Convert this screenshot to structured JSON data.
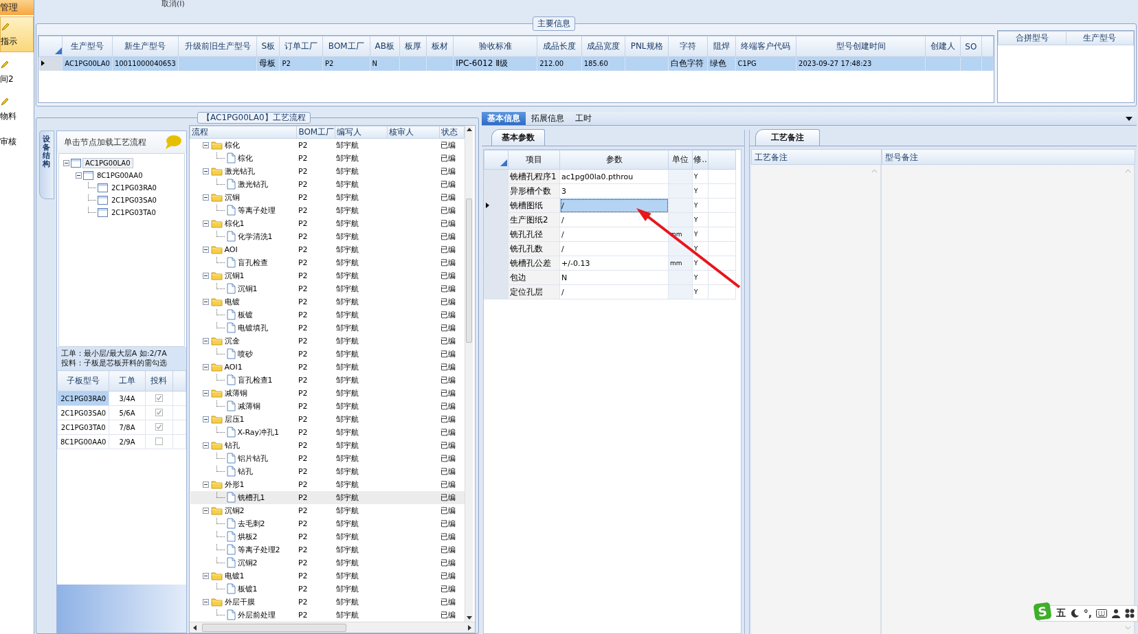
{
  "top_strip": {
    "cut_label": "取消(I)"
  },
  "sidebar": {
    "items": [
      {
        "kind": "header",
        "label": "管理"
      },
      {
        "kind": "icon_item",
        "label": "指示",
        "selected": true
      },
      {
        "kind": "icon_item",
        "label": "间2",
        "selected": false
      },
      {
        "kind": "icon_item",
        "label": "物料",
        "selected": false
      },
      {
        "kind": "item",
        "label": "审核",
        "selected": false
      }
    ]
  },
  "main_info": {
    "title": "主要信息",
    "columns": [
      "生产型号",
      "新生产型号",
      "升级前旧生产型号",
      "S板",
      "订单工厂",
      "BOM工厂",
      "AB板",
      "板厚",
      "板材",
      "验收标准",
      "成品长度",
      "成品宽度",
      "PNL规格",
      "字符",
      "阻焊",
      "终端客户代码",
      "型号创建时间",
      "创建人",
      "SO"
    ],
    "rows": [
      {
        "selected": true,
        "cells": [
          "AC1PG00LA0",
          "10011000040653",
          null,
          "母板",
          "P2",
          "P2",
          "N",
          null,
          null,
          "IPC-6012 Ⅱ级",
          "212.00",
          "185.60",
          null,
          "白色字符",
          "绿色",
          "C1PG",
          "2023-09-27 17:48:23",
          null,
          null
        ]
      }
    ],
    "merge_columns": [
      "合拼型号",
      "生产型号"
    ]
  },
  "process": {
    "title": "【AC1PG00LA0】工艺流程",
    "side_tab": "设备结构",
    "tree_hint": "单击节点加载工艺流程",
    "structure": [
      {
        "label": "AC1PG00LA0",
        "selected": true,
        "expanded": true,
        "children": [
          {
            "label": "8C1PG00AA0",
            "selected": false,
            "expanded": true,
            "children": [
              {
                "label": "2C1PG03RA0",
                "selected": false
              },
              {
                "label": "2C1PG03SA0",
                "selected": false
              },
              {
                "label": "2C1PG03TA0",
                "selected": false
              }
            ]
          }
        ]
      }
    ],
    "notes": [
      "工单：最小层/最大层A 如:2/7A",
      "投料：子板是芯板开料的需勾选"
    ],
    "sub_columns": [
      "子板型号",
      "工单",
      "投料"
    ],
    "sub_rows": [
      {
        "model": "2C1PG03RA0",
        "order": "3/4A",
        "checked": true,
        "selected": true
      },
      {
        "model": "2C1PG03SA0",
        "order": "5/6A",
        "checked": true,
        "selected": false
      },
      {
        "model": "2C1PG03TA0",
        "order": "7/8A",
        "checked": true,
        "selected": false
      },
      {
        "model": "8C1PG00AA0",
        "order": "2/9A",
        "checked": false,
        "selected": false
      }
    ],
    "flow_columns": [
      "流程",
      "BOM工厂",
      "编写人",
      "核审人",
      "状态"
    ],
    "flow": [
      {
        "label": "棕化",
        "bom": "P2",
        "writer": "邹宇航",
        "status": "已编",
        "expanded": true,
        "selected": false,
        "children": [
          {
            "label": "棕化",
            "bom": "P2",
            "writer": "邹宇航",
            "status": "已编",
            "selected": false
          }
        ]
      },
      {
        "label": "激光钻孔",
        "bom": "P2",
        "writer": "邹宇航",
        "status": "已编",
        "expanded": true,
        "selected": false,
        "children": [
          {
            "label": "激光钻孔",
            "bom": "P2",
            "writer": "邹宇航",
            "status": "已编",
            "selected": false
          }
        ]
      },
      {
        "label": "沉铜",
        "bom": "P2",
        "writer": "邹宇航",
        "status": "已编",
        "expanded": true,
        "selected": false,
        "children": [
          {
            "label": "等离子处理",
            "bom": "P2",
            "writer": "邹宇航",
            "status": "已编",
            "selected": false
          }
        ]
      },
      {
        "label": "棕化1",
        "bom": "P2",
        "writer": "邹宇航",
        "status": "已编",
        "expanded": true,
        "selected": false,
        "children": [
          {
            "label": "化学清洗1",
            "bom": "P2",
            "writer": "邹宇航",
            "status": "已编",
            "selected": false
          }
        ]
      },
      {
        "label": "AOI",
        "bom": "P2",
        "writer": "邹宇航",
        "status": "已编",
        "expanded": true,
        "selected": false,
        "children": [
          {
            "label": "盲孔检查",
            "bom": "P2",
            "writer": "邹宇航",
            "status": "已编",
            "selected": false
          }
        ]
      },
      {
        "label": "沉铜1",
        "bom": "P2",
        "writer": "邹宇航",
        "status": "已编",
        "expanded": true,
        "selected": false,
        "children": [
          {
            "label": "沉铜1",
            "bom": "P2",
            "writer": "邹宇航",
            "status": "已编",
            "selected": false
          }
        ]
      },
      {
        "label": "电镀",
        "bom": "P2",
        "writer": "邹宇航",
        "status": "已编",
        "expanded": true,
        "selected": false,
        "children": [
          {
            "label": "板镀",
            "bom": "P2",
            "writer": "邹宇航",
            "status": "已编",
            "selected": false
          },
          {
            "label": "电镀填孔",
            "bom": "P2",
            "writer": "邹宇航",
            "status": "已编",
            "selected": false
          }
        ]
      },
      {
        "label": "沉金",
        "bom": "P2",
        "writer": "邹宇航",
        "status": "已编",
        "expanded": true,
        "selected": false,
        "children": [
          {
            "label": "喷砂",
            "bom": "P2",
            "writer": "邹宇航",
            "status": "已编",
            "selected": false
          }
        ]
      },
      {
        "label": "AOI1",
        "bom": "P2",
        "writer": "邹宇航",
        "status": "已编",
        "expanded": true,
        "selected": false,
        "children": [
          {
            "label": "盲孔检查1",
            "bom": "P2",
            "writer": "邹宇航",
            "status": "已编",
            "selected": false
          }
        ]
      },
      {
        "label": "减薄铜",
        "bom": "P2",
        "writer": "邹宇航",
        "status": "已编",
        "expanded": true,
        "selected": false,
        "children": [
          {
            "label": "减薄铜",
            "bom": "P2",
            "writer": "邹宇航",
            "status": "已编",
            "selected": false
          }
        ]
      },
      {
        "label": "层压1",
        "bom": "P2",
        "writer": "邹宇航",
        "status": "已编",
        "expanded": true,
        "selected": false,
        "children": [
          {
            "label": "X-Ray冲孔1",
            "bom": "P2",
            "writer": "邹宇航",
            "status": "已编",
            "selected": false
          }
        ]
      },
      {
        "label": "钻孔",
        "bom": "P2",
        "writer": "邹宇航",
        "status": "已编",
        "expanded": true,
        "selected": false,
        "children": [
          {
            "label": "铝片钻孔",
            "bom": "P2",
            "writer": "邹宇航",
            "status": "已编",
            "selected": false
          },
          {
            "label": "钻孔",
            "bom": "P2",
            "writer": "邹宇航",
            "status": "已编",
            "selected": false
          }
        ]
      },
      {
        "label": "外形1",
        "bom": "P2",
        "writer": "邹宇航",
        "status": "已编",
        "expanded": true,
        "selected": false,
        "children": [
          {
            "label": "铣槽孔1",
            "bom": "P2",
            "writer": "邹宇航",
            "status": "已编",
            "selected": true
          }
        ]
      },
      {
        "label": "沉铜2",
        "bom": "P2",
        "writer": "邹宇航",
        "status": "已编",
        "expanded": true,
        "selected": false,
        "children": [
          {
            "label": "去毛刺2",
            "bom": "P2",
            "writer": "邹宇航",
            "status": "已编",
            "selected": false
          },
          {
            "label": "烘板2",
            "bom": "P2",
            "writer": "邹宇航",
            "status": "已编",
            "selected": false
          },
          {
            "label": "等离子处理2",
            "bom": "P2",
            "writer": "邹宇航",
            "status": "已编",
            "selected": false
          },
          {
            "label": "沉铜2",
            "bom": "P2",
            "writer": "邹宇航",
            "status": "已编",
            "selected": false
          }
        ]
      },
      {
        "label": "电镀1",
        "bom": "P2",
        "writer": "邹宇航",
        "status": "已编",
        "expanded": true,
        "selected": false,
        "children": [
          {
            "label": "板镀1",
            "bom": "P2",
            "writer": "邹宇航",
            "status": "已编",
            "selected": false
          }
        ]
      },
      {
        "label": "外层干膜",
        "bom": "P2",
        "writer": "邹宇航",
        "status": "已编",
        "expanded": true,
        "selected": false,
        "children": [
          {
            "label": "外层前处理",
            "bom": "P2",
            "writer": "邹宇航",
            "status": "已编",
            "selected": false
          }
        ]
      }
    ]
  },
  "detail_tabs": [
    {
      "label": "基本信息",
      "selected": true
    },
    {
      "label": "拓展信息",
      "selected": false
    },
    {
      "label": "工时",
      "selected": false
    }
  ],
  "basic_params": {
    "tab": "基本参数",
    "columns": [
      "项目",
      "参数",
      "单位",
      "修.."
    ],
    "rows": [
      {
        "item": "铣槽孔程序1",
        "value": "ac1pg00la0.pthrou",
        "flag": "Y",
        "selected": false
      },
      {
        "item": "异形槽个数",
        "value": "3",
        "flag": "Y",
        "selected": false
      },
      {
        "item": "铣槽图纸",
        "value": "/",
        "flag": "Y",
        "selected": true
      },
      {
        "item": "生产图纸2",
        "value": "/",
        "flag": "Y",
        "selected": false
      },
      {
        "item": "铣孔孔径",
        "value": "/",
        "unit": "mm",
        "flag": "Y",
        "selected": false
      },
      {
        "item": "铣孔孔数",
        "value": "/",
        "flag": "Y",
        "selected": false
      },
      {
        "item": "铣槽孔公差",
        "value": "+/-0.13",
        "unit": "mm",
        "flag": "Y",
        "selected": false
      },
      {
        "item": "包边",
        "value": "N",
        "flag": "Y",
        "selected": false
      },
      {
        "item": "定位孔层",
        "value": "/",
        "flag": "Y",
        "selected": false
      }
    ]
  },
  "remarks": {
    "tab": "工艺备注",
    "columns": [
      "工艺备注",
      "型号备注"
    ]
  },
  "ime_bar": {
    "logo": "S",
    "mode": "五",
    "punct": "°,"
  }
}
